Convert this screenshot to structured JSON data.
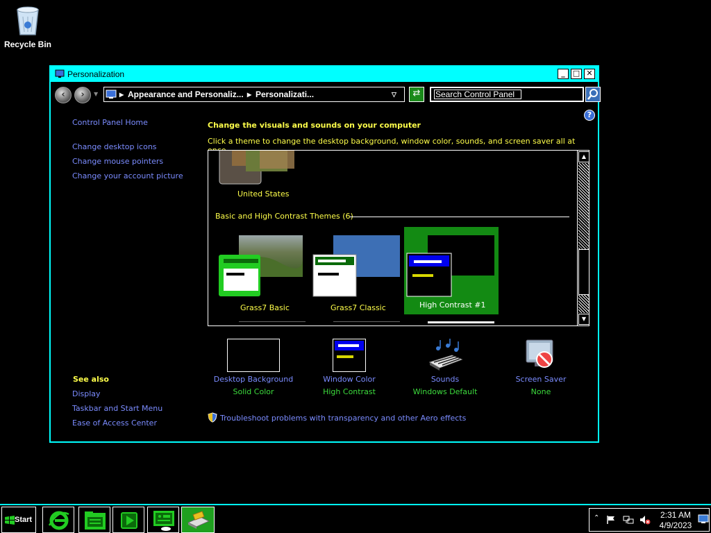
{
  "desktop": {
    "recycle_bin_label": "Recycle Bin"
  },
  "window": {
    "title": "Personalization",
    "controls": {
      "minimize": "_",
      "maximize": "□",
      "close": "✕"
    }
  },
  "address": {
    "crumbs": [
      "Appearance and Personaliz...",
      "Personalizati..."
    ],
    "search_placeholder": "Search Control Panel"
  },
  "left_pane": {
    "home": "Control Panel Home",
    "tasks": [
      "Change desktop icons",
      "Change mouse pointers",
      "Change your account picture"
    ],
    "see_also_title": "See also",
    "see_also": [
      "Display",
      "Taskbar and Start Menu",
      "Ease of Access Center"
    ]
  },
  "main": {
    "heading": "Change the visuals and sounds on your computer",
    "subheading": "Click a theme to change the desktop background, window color, sounds, and screen saver all at once."
  },
  "themes": {
    "partial_theme": "United States",
    "group_label": "Basic and High Contrast Themes (6)",
    "items": [
      {
        "name": "Grass7 Basic",
        "selected": false
      },
      {
        "name": "Grass7 Classic",
        "selected": false
      },
      {
        "name": "High Contrast #1",
        "selected": true
      }
    ]
  },
  "settings": [
    {
      "title": "Desktop Background",
      "value": "Solid Color"
    },
    {
      "title": "Window Color",
      "value": "High Contrast"
    },
    {
      "title": "Sounds",
      "value": "Windows Default"
    },
    {
      "title": "Screen Saver",
      "value": "None"
    }
  ],
  "troubleshoot_link": "Troubleshoot problems with transparency and other Aero effects",
  "taskbar": {
    "start_label": "Start",
    "time": "2:31 AM",
    "date": "4/9/2023"
  },
  "colors": {
    "accent_cyan": "#00ffff",
    "link_blue": "#7b8cff",
    "heading_yellow": "#ffff4a",
    "value_green": "#3ddc3d",
    "selected_green": "#138a13"
  }
}
